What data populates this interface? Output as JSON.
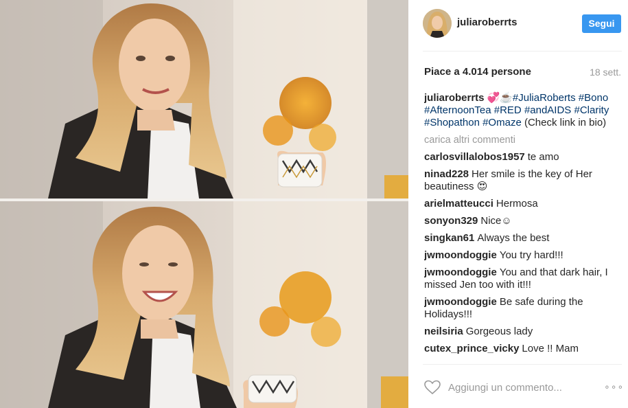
{
  "post": {
    "username": "juliaroberrts",
    "follow_label": "Segui",
    "likes_text": "Piace a 4.014 persone",
    "age_text": "18 sett."
  },
  "caption": {
    "username": "juliaroberrts",
    "emoji": "💞☕️",
    "tags": [
      "#JuliaRoberts",
      "#Bono",
      "#AfternoonTea",
      "#RED",
      "#andAIDS",
      "#Clarity",
      "#Shopathon",
      "#Omaze"
    ],
    "suffix": "(Check link in bio)"
  },
  "load_more_label": "carica altri commenti",
  "comments": [
    {
      "user": "carlosvillalobos1957",
      "text": "te amo"
    },
    {
      "user": "ninad228",
      "text": "Her smile is the key of Her beautiness 😍"
    },
    {
      "user": "arielmatteucci",
      "text": "Hermosa"
    },
    {
      "user": "sonyon329",
      "text": "Nice☺"
    },
    {
      "user": "singkan61",
      "text": "Always the best"
    },
    {
      "user": "jwmoondoggie",
      "text": "You try hard!!!"
    },
    {
      "user": "jwmoondoggie",
      "text": "You and that dark hair, I missed Jen too with it!!!"
    },
    {
      "user": "jwmoondoggie",
      "text": "Be safe during the Holidays!!!"
    },
    {
      "user": "neilsiria",
      "text": "Gorgeous lady"
    },
    {
      "user": "cutex_prince_vicky",
      "text": "Love !! Mam"
    }
  ],
  "comment_input": {
    "placeholder": "Aggiungi un commento..."
  },
  "more_label": "∘∘∘",
  "icons": {
    "like": "heart-outline-icon",
    "more": "more-options-icon"
  },
  "colors": {
    "link": "#003569",
    "button": "#3897f0",
    "muted": "#999999"
  }
}
